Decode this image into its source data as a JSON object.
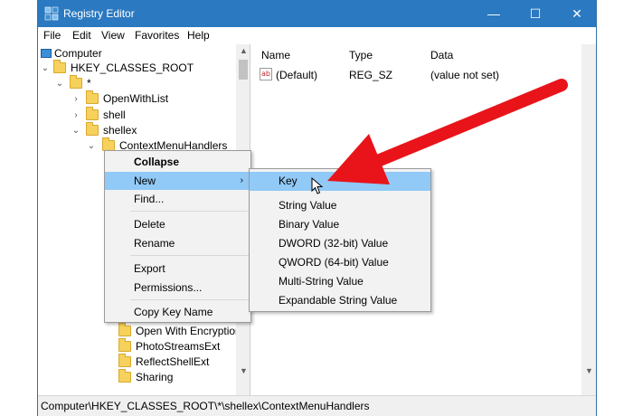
{
  "window": {
    "title": "Registry Editor",
    "minimize": "—",
    "maximize": "☐",
    "close": "✕"
  },
  "menubar": [
    "File",
    "Edit",
    "View",
    "Favorites",
    "Help"
  ],
  "tree": {
    "rows": [
      {
        "label": "Computer",
        "icon": "computer-icon"
      },
      {
        "label": "HKEY_CLASSES_ROOT",
        "expander": "⌄",
        "icon": "folder-icon"
      },
      {
        "label": "*",
        "expander": "⌄",
        "icon": "folder-icon"
      },
      {
        "label": "OpenWithList",
        "expander": "›",
        "icon": "folder-icon"
      },
      {
        "label": "shell",
        "expander": "›",
        "icon": "folder-icon"
      },
      {
        "label": "shellex",
        "expander": "⌄",
        "icon": "folder-icon"
      },
      {
        "label": "ContextMenuHandlers",
        "expander": "⌄",
        "icon": "folder-icon"
      },
      {
        "label": "Open With Encryption",
        "icon": "folder-icon"
      },
      {
        "label": "PhotoStreamsExt",
        "icon": "folder-icon"
      },
      {
        "label": "ReflectShellExt",
        "icon": "folder-icon"
      },
      {
        "label": "Sharing",
        "icon": "folder-icon"
      }
    ]
  },
  "list": {
    "headers": {
      "name": "Name",
      "type": "Type",
      "data": "Data"
    },
    "rows": [
      {
        "name": "(Default)",
        "type": "REG_SZ",
        "data": "(value not set)",
        "icon": "ab"
      }
    ]
  },
  "context_menu": {
    "items": [
      "Collapse",
      "New",
      "Find...",
      "Delete",
      "Rename",
      "Export",
      "Permissions...",
      "Copy Key Name"
    ],
    "submenu_arrow": "›"
  },
  "submenu": {
    "items": [
      "Key",
      "String Value",
      "Binary Value",
      "DWORD (32-bit) Value",
      "QWORD (64-bit) Value",
      "Multi-String Value",
      "Expandable String Value"
    ]
  },
  "statusbar": {
    "path": "Computer\\HKEY_CLASSES_ROOT\\*\\shellex\\ContextMenuHandlers"
  },
  "colors": {
    "titlebar": "#2b79c0",
    "highlight": "#91c9f7",
    "annotation_arrow": "#e8141a"
  }
}
